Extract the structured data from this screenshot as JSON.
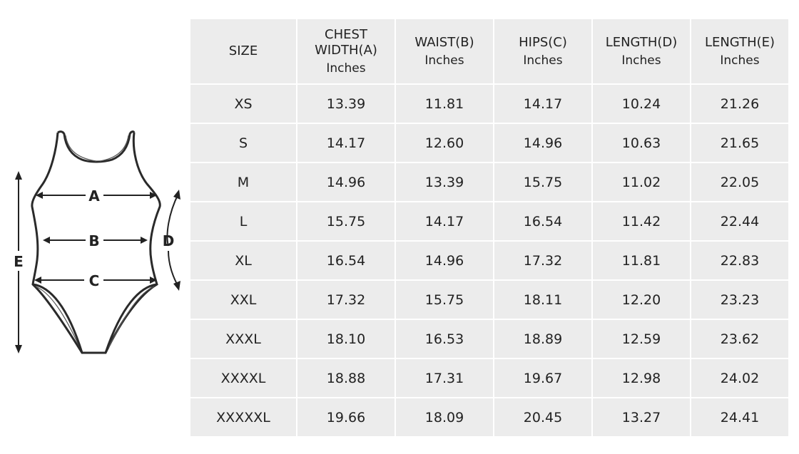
{
  "diagram": {
    "labels": {
      "a": "A",
      "b": "B",
      "c": "C",
      "d": "D",
      "e": "E"
    }
  },
  "table": {
    "headers": [
      {
        "title": "SIZE",
        "unit": ""
      },
      {
        "title": "CHEST WIDTH(A)",
        "unit": "Inches"
      },
      {
        "title": "WAIST(B)",
        "unit": "Inches"
      },
      {
        "title": "HIPS(C)",
        "unit": "Inches"
      },
      {
        "title": "LENGTH(D)",
        "unit": "Inches"
      },
      {
        "title": "LENGTH(E)",
        "unit": "Inches"
      }
    ],
    "rows": [
      [
        "XS",
        "13.39",
        "11.81",
        "14.17",
        "10.24",
        "21.26"
      ],
      [
        "S",
        "14.17",
        "12.60",
        "14.96",
        "10.63",
        "21.65"
      ],
      [
        "M",
        "14.96",
        "13.39",
        "15.75",
        "11.02",
        "22.05"
      ],
      [
        "L",
        "15.75",
        "14.17",
        "16.54",
        "11.42",
        "22.44"
      ],
      [
        "XL",
        "16.54",
        "14.96",
        "17.32",
        "11.81",
        "22.83"
      ],
      [
        "XXL",
        "17.32",
        "15.75",
        "18.11",
        "12.20",
        "23.23"
      ],
      [
        "XXXL",
        "18.10",
        "16.53",
        "18.89",
        "12.59",
        "23.62"
      ],
      [
        "XXXXL",
        "18.88",
        "17.31",
        "19.67",
        "12.98",
        "24.02"
      ],
      [
        "XXXXXL",
        "19.66",
        "18.09",
        "20.45",
        "13.27",
        "24.41"
      ]
    ]
  }
}
